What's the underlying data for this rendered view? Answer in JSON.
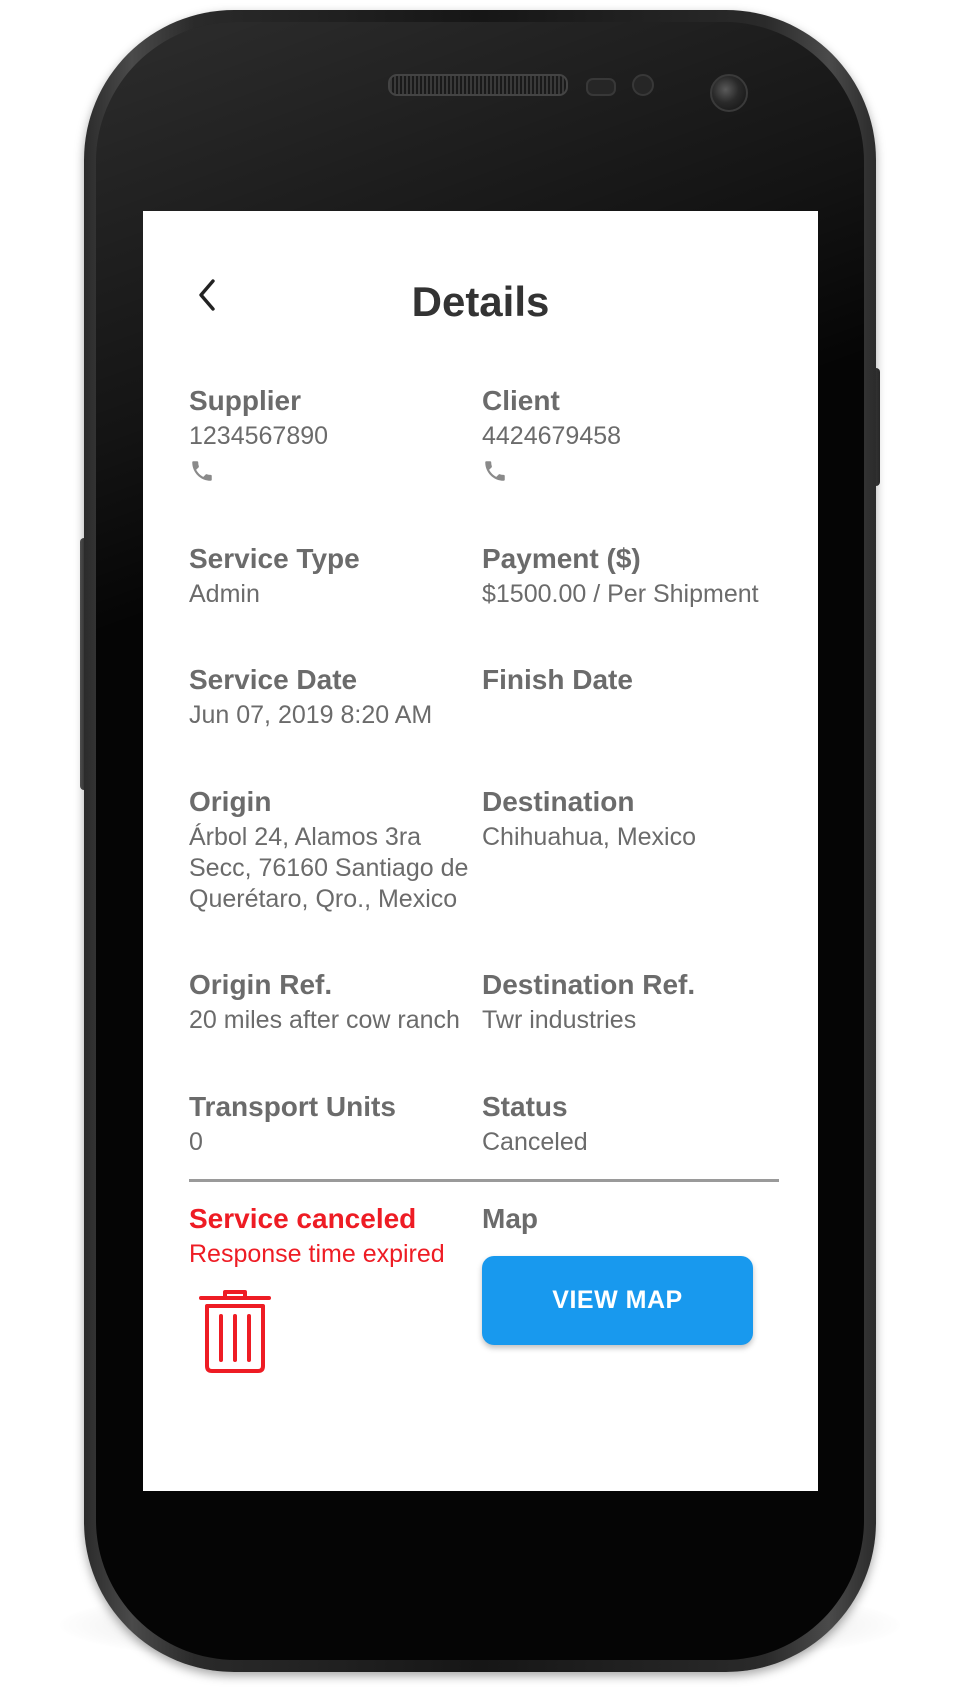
{
  "header": {
    "title": "Details",
    "back_icon": "chevron-left-icon"
  },
  "details": {
    "supplier": {
      "label": "Supplier",
      "value": "1234567890",
      "icon": "phone-icon"
    },
    "client": {
      "label": "Client",
      "value": "4424679458",
      "icon": "phone-icon"
    },
    "service_type": {
      "label": "Service Type",
      "value": "Admin"
    },
    "payment": {
      "label": "Payment ($)",
      "value": "$1500.00 / Per Shipment"
    },
    "service_date": {
      "label": "Service Date",
      "value": "Jun 07, 2019 8:20 AM"
    },
    "finish_date": {
      "label": "Finish Date",
      "value": ""
    },
    "origin": {
      "label": "Origin",
      "value": "Árbol 24, Alamos 3ra Secc, 76160 Santiago de Querétaro, Qro., Mexico"
    },
    "destination": {
      "label": "Destination",
      "value": "Chihuahua, Mexico"
    },
    "origin_ref": {
      "label": "Origin Ref.",
      "value": "20 miles after cow ranch"
    },
    "destination_ref": {
      "label": "Destination Ref.",
      "value": "Twr industries"
    },
    "transport_units": {
      "label": "Transport Units",
      "value": "0"
    },
    "status": {
      "label": "Status",
      "value": "Canceled"
    }
  },
  "cancellation": {
    "title": "Service canceled",
    "reason": "Response time expired",
    "icon": "trash-icon"
  },
  "map": {
    "label": "Map",
    "button_label": "VIEW MAP"
  },
  "colors": {
    "text": "#6b6b6b",
    "title": "#333333",
    "danger": "#ee1c24",
    "accent": "#1899ee",
    "divider": "#9a9a9a"
  }
}
